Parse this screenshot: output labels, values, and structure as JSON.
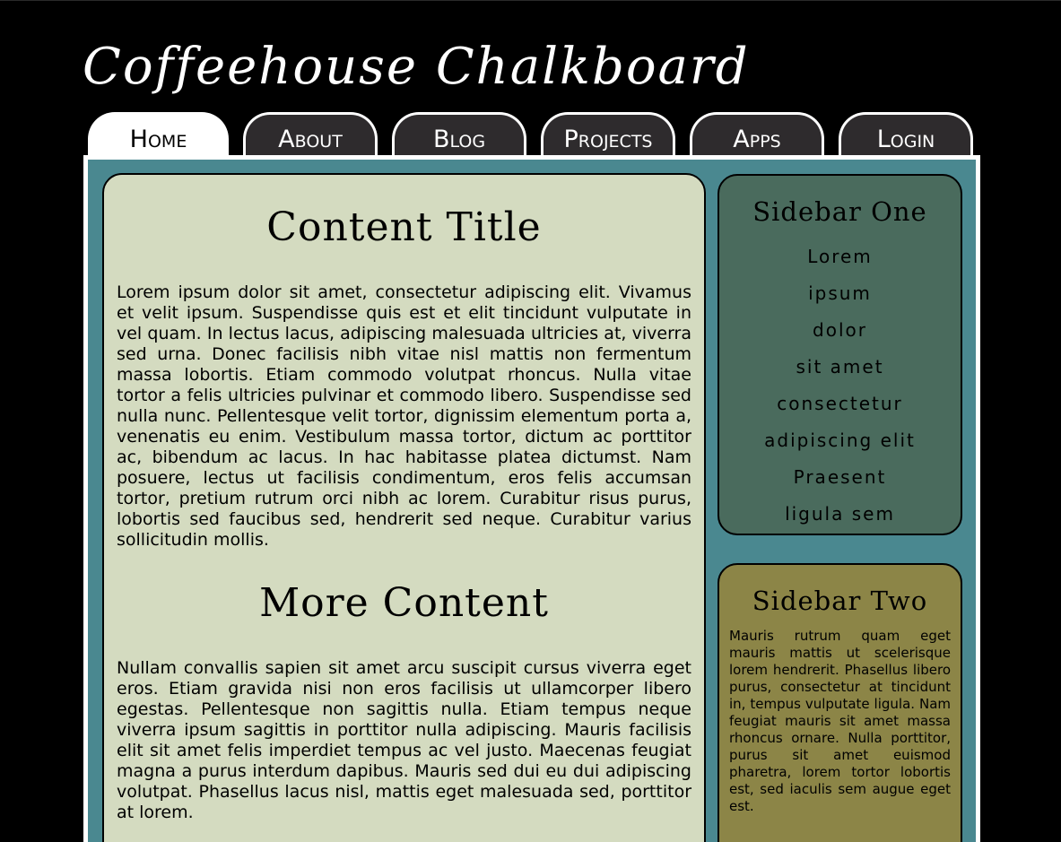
{
  "site": {
    "title": "Coffeehouse Chalkboard"
  },
  "nav": {
    "tabs": [
      {
        "label": "Home",
        "active": true
      },
      {
        "label": "About",
        "active": false
      },
      {
        "label": "Blog",
        "active": false
      },
      {
        "label": "Projects",
        "active": false
      },
      {
        "label": "Apps",
        "active": false
      },
      {
        "label": "Login",
        "active": false
      }
    ]
  },
  "content": {
    "title": "Content Title",
    "paragraph1": "Lorem ipsum dolor sit amet, consectetur adipiscing elit. Vivamus et velit ipsum. Suspendisse quis est et elit tincidunt vulputate in vel quam. In lectus lacus, adipiscing malesuada ultricies at, viverra sed urna. Donec facilisis nibh vitae nisl mattis non fermentum massa lobortis. Etiam commodo volutpat rhoncus. Nulla vitae tortor a felis ultricies pulvinar et commodo libero. Suspendisse sed nulla nunc. Pellentesque velit tortor, dignissim elementum porta a, venenatis eu enim. Vestibulum massa tortor, dictum ac porttitor ac, bibendum ac lacus. In hac habitasse platea dictumst. Nam posuere, lectus ut facilisis condimentum, eros felis accumsan tortor, pretium rutrum orci nibh ac lorem. Curabitur risus purus, lobortis sed faucibus sed, hendrerit sed neque. Curabitur varius sollicitudin mollis.",
    "subtitle": "More Content",
    "paragraph2": "Nullam convallis sapien sit amet arcu suscipit cursus viverra eget eros. Etiam gravida nisi non eros facilisis ut ullamcorper libero egestas. Pellentesque non sagittis nulla. Etiam tempus neque viverra ipsum sagittis in porttitor nulla adipiscing. Mauris facilisis elit sit amet felis imperdiet tempus ac vel justo. Maecenas feugiat magna a purus interdum dapibus. Mauris sed dui eu dui adipiscing volutpat. Phasellus lacus nisl, mattis eget malesuada sed, porttitor at lorem."
  },
  "sidebar_one": {
    "title": "Sidebar One",
    "links": [
      "Lorem",
      "ipsum",
      "dolor",
      "sit amet",
      "consectetur",
      "adipiscing elit",
      "Praesent",
      "ligula sem"
    ]
  },
  "sidebar_two": {
    "title": "Sidebar Two",
    "text": "Mauris rutrum quam eget mauris mattis ut scelerisque lorem hendrerit. Phasellus libero purus, consectetur at tincidunt in, tempus vulputate ligula. Nam feugiat mauris sit amet massa rhoncus ornare. Nulla porttitor, purus sit amet euismod pharetra, lorem tortor lobortis est, sed iaculis sem augue eget est."
  },
  "colors": {
    "background": "#000000",
    "frame": "#4a8890",
    "content": "#d4dbc0",
    "sidebar_one": "#4a6b5d",
    "sidebar_two": "#8c8547",
    "tab": "#2e2b2d",
    "tab_active": "#ffffff"
  }
}
